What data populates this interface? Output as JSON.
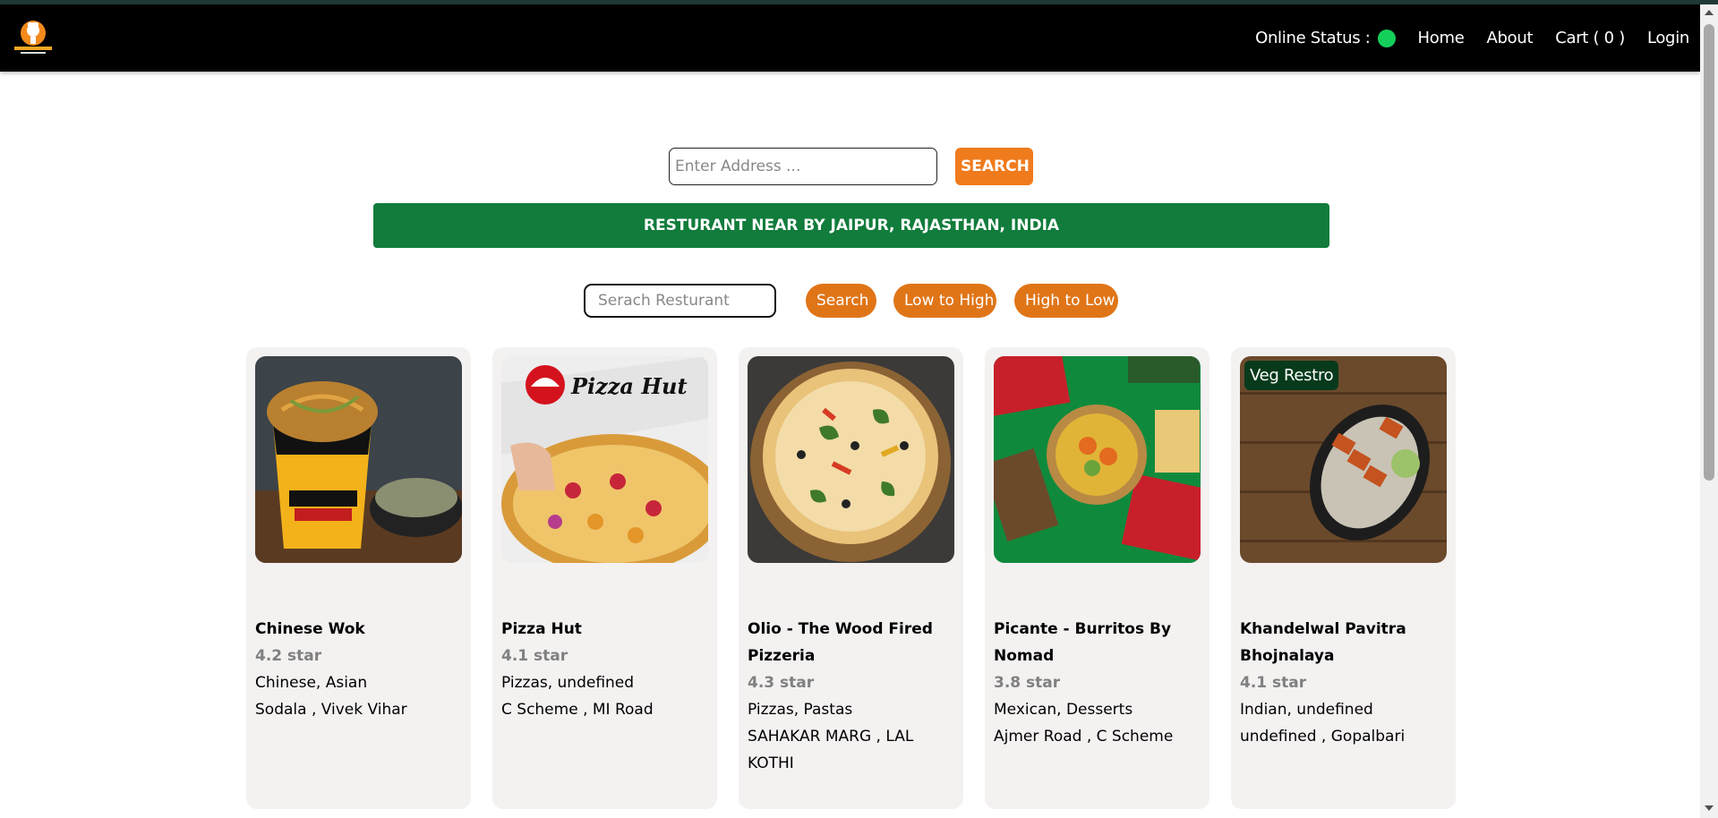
{
  "nav": {
    "status_label": "Online Status :",
    "status_color": "#14d05a",
    "home": "Home",
    "about": "About",
    "cart": "Cart ( 0 )",
    "login": "Login"
  },
  "logo": {
    "icon": "hungryhut-logo"
  },
  "address": {
    "placeholder": "Enter Address ...",
    "button": "SEARCH"
  },
  "banner": {
    "text": "RESTURANT NEAR BY JAIPUR, RAJASTHAN, INDIA"
  },
  "filters": {
    "placeholder": "Serach Resturant",
    "search": "Search",
    "low_to_high": "Low to High",
    "high_to_low": "High to Low"
  },
  "restaurants": [
    {
      "name": "Chinese Wok",
      "rating": "4.2 star",
      "cuisines": "Chinese, Asian",
      "location": "Sodala , Vivek Vihar"
    },
    {
      "name": "Pizza Hut",
      "rating": "4.1 star",
      "cuisines": "Pizzas, undefined",
      "location": "C Scheme , MI Road",
      "image_text": "Pizza Hut"
    },
    {
      "name": "Olio - The Wood Fired Pizzeria",
      "rating": "4.3 star",
      "cuisines": "Pizzas, Pastas",
      "location": "SAHAKAR MARG , LAL KOTHI"
    },
    {
      "name": "Picante - Burritos By Nomad",
      "rating": "3.8 star",
      "cuisines": "Mexican, Desserts",
      "location": "Ajmer Road , C Scheme"
    },
    {
      "name": "Khandelwal Pavitra Bhojnalaya",
      "rating": "4.1 star",
      "cuisines": "Indian, undefined",
      "location": "undefined , Gopalbari",
      "badge": "Veg Restro"
    }
  ],
  "colors": {
    "accent_orange": "#e07518",
    "banner_green": "#117c3c",
    "card_bg": "#f4f1f1"
  }
}
